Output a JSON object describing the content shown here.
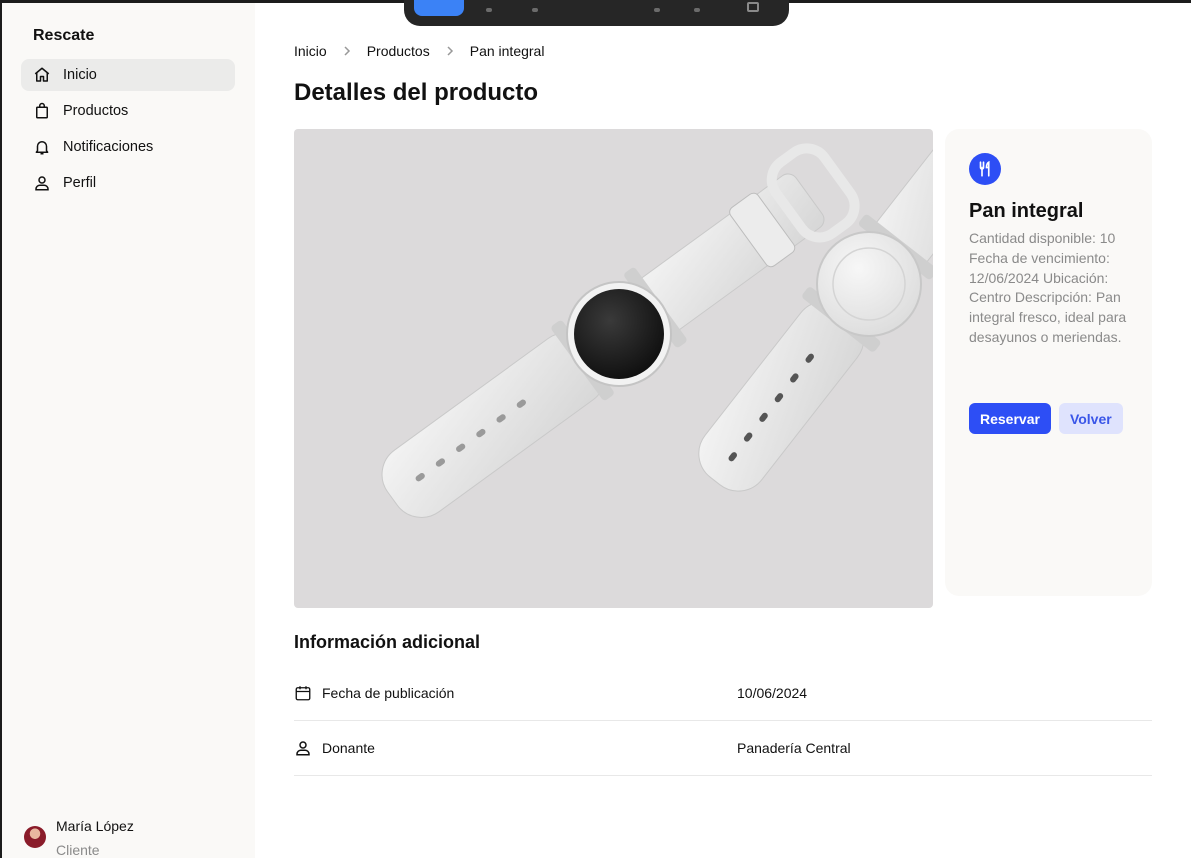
{
  "sidebar": {
    "brand": "Rescate",
    "items": [
      {
        "label": "Inicio",
        "icon": "home-icon",
        "active": true
      },
      {
        "label": "Productos",
        "icon": "shopping-bag-icon",
        "active": false
      },
      {
        "label": "Notificaciones",
        "icon": "bell-icon",
        "active": false
      },
      {
        "label": "Perfil",
        "icon": "user-icon",
        "active": false
      }
    ],
    "user": {
      "name": "María López",
      "role": "Cliente"
    }
  },
  "breadcrumb": [
    "Inicio",
    "Productos",
    "Pan integral"
  ],
  "page_title": "Detalles del producto",
  "product": {
    "icon": "utensils-icon",
    "name": "Pan integral",
    "details": "Cantidad disponible: 10 Fecha de vencimiento: 12/06/2024 Ubicación: Centro Descripción: Pan integral fresco, ideal para desayunos o meriendas.",
    "reserve_label": "Reservar",
    "back_label": "Volver"
  },
  "additional": {
    "title": "Información adicional",
    "rows": [
      {
        "icon": "calendar-icon",
        "label": "Fecha de publicación",
        "value": "10/06/2024"
      },
      {
        "icon": "user-icon",
        "label": "Donante",
        "value": "Panadería Central"
      }
    ]
  },
  "colors": {
    "accent": "#2d4ef5",
    "accent_soft": "#dfe3fd",
    "sidebar_bg": "#faf9f7",
    "muted": "#8a8a8a"
  }
}
